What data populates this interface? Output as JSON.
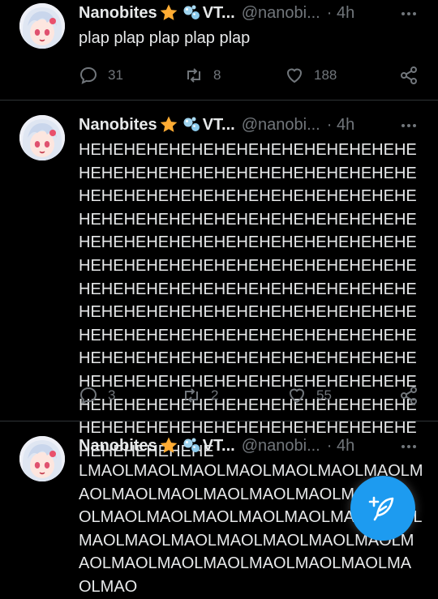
{
  "posts": [
    {
      "display_name": "Nanobites",
      "emoji_1": "star",
      "emoji_2": "bubbles",
      "name_suffix": "VT...",
      "handle": "@nanobi...",
      "time": "· 4h",
      "text": "plap plap plap plap plap",
      "replies": "31",
      "reposts": "8",
      "likes": "188"
    },
    {
      "display_name": "Nanobites",
      "emoji_1": "star",
      "emoji_2": "bubbles",
      "name_suffix": "VT...",
      "handle": "@nanobi...",
      "time": "· 4h",
      "text": "HEHEHEHEHEHEHEHEHEHEHEHEHEHEHEHEHEHEHEHEHEHEHEHEHEHEHEHEHEHEHEHEHEHEHEHEHEHEHEHEHEHEHEHEHEHEHEHEHEHEHEHEHEHEHEHEHEHEHEHEHEHEHEHEHEHEHEHEHEHEHEHEHEHEHEHEHEHEHEHEHEHEHEHEHEHEHEHEHEHEHEHEHEHEHEHEHEHEHEHEHEHEHEHEHEHEHEHEHEHEHEHEHEHEHEHEHEHEHEHEHEHEHEHEHEHEHEHEHEHEHEHEHEHEHEHEHEHEHEHEHEHEHEHEHEHEHEHEHEHEHEHEHEHEHEHEHEHEHEHEHEHEHEHEHEHEHEHEHEHEHEHEHEHEHEHEHEHEHEHEHEHEHEHEHEHEHEHEHEHEHEHEHEHEHEHEHEHEHEHEHE",
      "replies": "3",
      "reposts": "2",
      "likes": "55"
    },
    {
      "display_name": "Nanobites",
      "emoji_1": "star",
      "emoji_2": "bubbles",
      "name_suffix": "VT...",
      "handle": "@nanobi...",
      "time": "· 4h",
      "text": "LMAOLMAOLMAOLMAOLMAOLMAOLMAOLMAOLMAOLMAOLMAOLMAOLMAOLMAOLMAOLMAOLMAOLMAOLMAOLMAOLMAOLMAOLMAOLMAOLMAOLMAOLMAOLMAOLMAOLMAOLMAOLMAOLMAOLMAOLMAOLMAOLMAOLMAO",
      "replies": "",
      "reposts": "",
      "likes": ""
    }
  ],
  "compose_button": {
    "icon": "feather-plus-icon",
    "color": "#1d9bf0"
  }
}
